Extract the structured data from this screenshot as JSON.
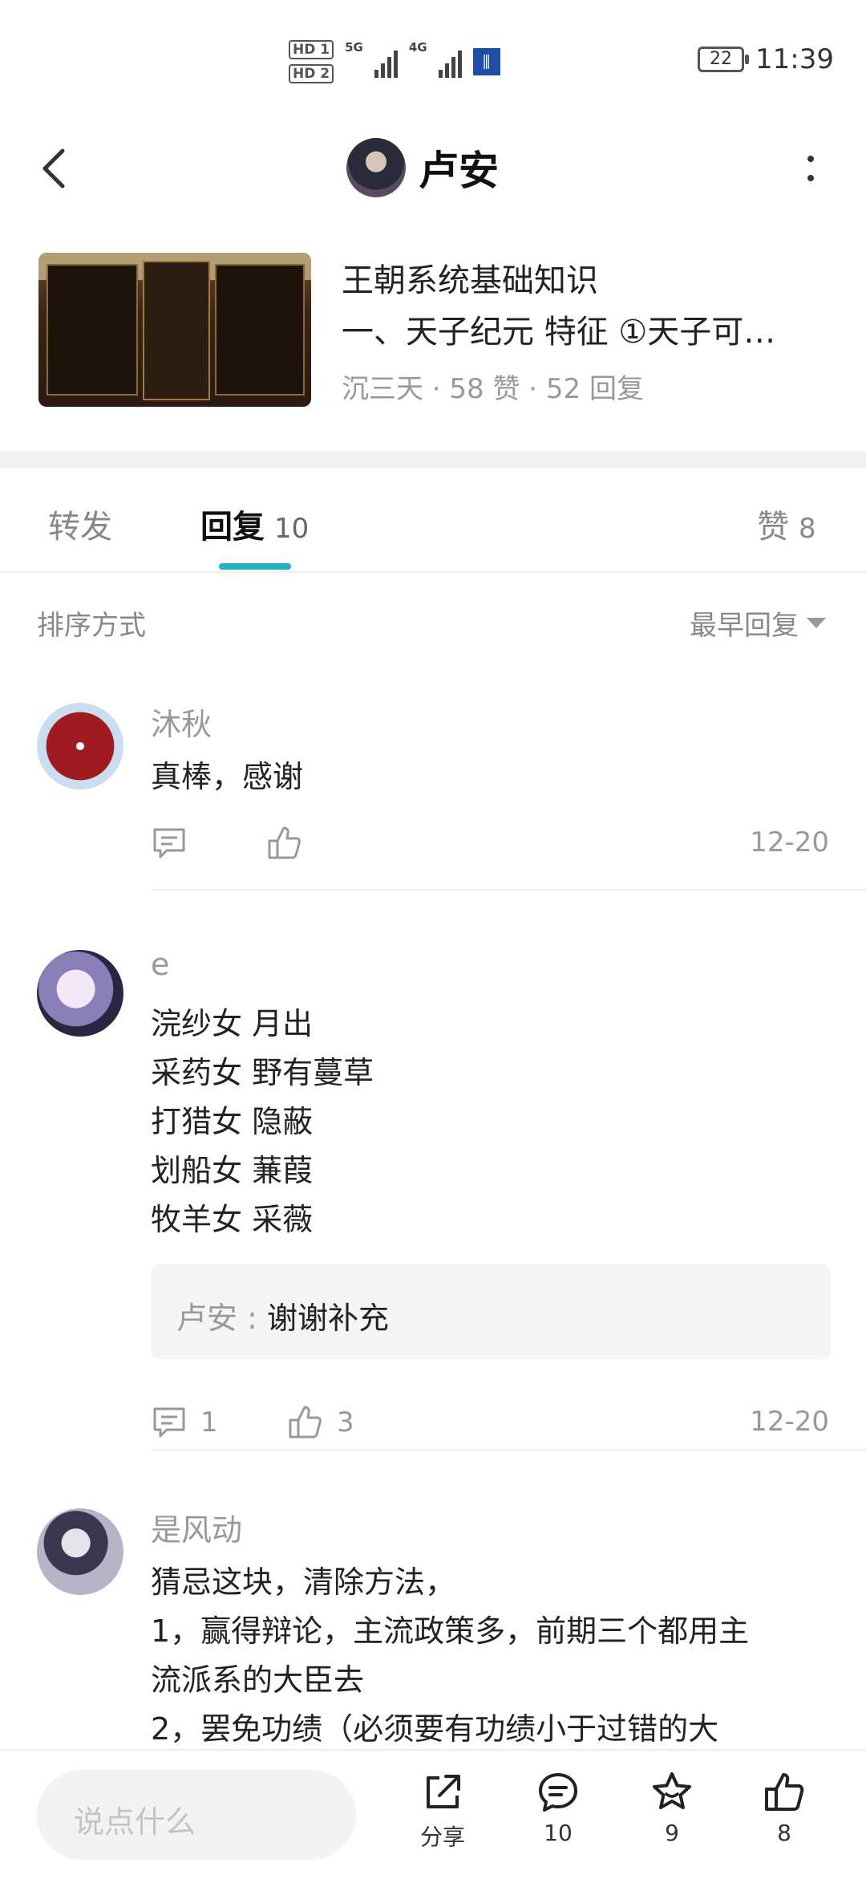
{
  "status_bar": {
    "hd1": "HD 1",
    "hd2": "HD 2",
    "network1": "5G",
    "network2": "4G",
    "battery": "22",
    "time": "11:39"
  },
  "header": {
    "user_name": "卢安"
  },
  "post": {
    "title": "王朝系统基础知识",
    "excerpt": "一、天子纪元 特征 ①天子可…",
    "meta": "沉三天 · 58 赞 · 52 回复"
  },
  "tabs": [
    {
      "label": "转发",
      "count": ""
    },
    {
      "label": "回复",
      "count": "10"
    },
    {
      "label": "赞",
      "count": "8"
    }
  ],
  "sort": {
    "label": "排序方式",
    "value": "最早回复"
  },
  "comments": [
    {
      "author": "沐秋",
      "lines": [
        "真棒，感谢"
      ],
      "reply_count": "",
      "like_count": "",
      "date": "12-20"
    },
    {
      "author": "e",
      "lines": [
        "浣纱女  月出",
        "采药女  野有蔓草",
        "打猎女  隐蔽",
        "划船女 蒹葭",
        "牧羊女 采薇"
      ],
      "reply": {
        "author": "卢安",
        "separator": " : ",
        "text": "谢谢补充"
      },
      "reply_count": "1",
      "like_count": "3",
      "date": "12-20"
    },
    {
      "author": "是风动",
      "lines": [
        "猜忌这块，清除方法，",
        "1，赢得辩论，主流政策多，前期三个都用主",
        "流派系的大臣去",
        "2，罢免功绩（必须要有功绩小于过错的大"
      ]
    }
  ],
  "bottom_bar": {
    "input_placeholder": "说点什么",
    "share_label": "分享",
    "comment_count": "10",
    "favorite_count": "9",
    "like_count": "8"
  }
}
